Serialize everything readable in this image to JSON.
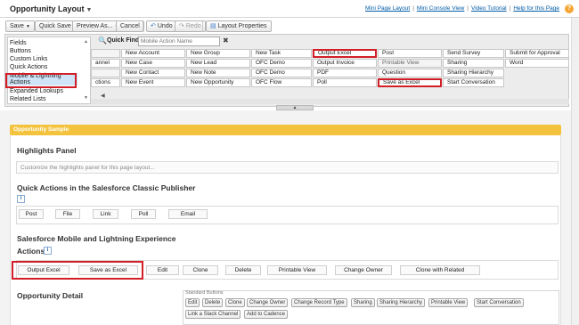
{
  "window": {
    "title": "Opportunity Layout",
    "links": [
      "Mini Page Layout",
      "Mini Console View",
      "Video Tutorial",
      "Help for this Page"
    ],
    "help_icon": "?"
  },
  "toolbar": {
    "save": "Save",
    "quick_save": "Quick Save",
    "preview_as": "Preview As...",
    "cancel": "Cancel",
    "undo": "Undo",
    "redo": "Redo",
    "layout_properties": "Layout Properties"
  },
  "palette": {
    "categories": [
      "Fields",
      "Buttons",
      "Custom Links",
      "Quick Actions",
      "Mobile & Lightning",
      "Actions",
      "Expanded Lookups",
      "Related Lists"
    ],
    "quick_find_label": "Quick Find",
    "quick_find_placeholder": "Mobile Action Name",
    "clear": "✖",
    "grid": [
      [
        "",
        "New Account",
        "New Group",
        "New Task",
        "Output Excel",
        "Post",
        "Send Survey",
        "Submit for Approval"
      ],
      [
        "annel",
        "New Case",
        "New Lead",
        "OFC Demo",
        "Output Invoice",
        "Printable View",
        "Sharing",
        "Word"
      ],
      [
        "",
        "New Contact",
        "New Note",
        "OFC Demo",
        "PDF",
        "Question",
        "Sharing Hierarchy",
        ""
      ],
      [
        "ctions",
        "New Event",
        "New Opportunity",
        "OFC Flow",
        "Poll",
        "Save as Excel",
        "Start Conversation",
        ""
      ]
    ],
    "splitter_glyph": "▲",
    "left_arrow": "◀"
  },
  "canvas": {
    "sample_title": "Opportunity Sample",
    "highlights_title": "Highlights Panel",
    "highlights_placeholder": "Customize the highlights panel for this page layout...",
    "classic_title": "Quick Actions in the Salesforce Classic Publisher",
    "info": "i",
    "classic_actions": [
      "Post",
      "File",
      "Link",
      "Poll",
      "Email"
    ],
    "mobile_title_line1": "Salesforce Mobile and Lightning Experience",
    "mobile_title_line2": "Actions",
    "mobile_actions": [
      "Output Excel",
      "Save as Excel",
      "Edit",
      "Clone",
      "Delete",
      "Printable View",
      "Change Owner",
      "Clone with Related"
    ],
    "detail_title": "Opportunity Detail",
    "standard_buttons_label": "Standard Buttons",
    "standard_buttons": [
      "Edit",
      "Delete",
      "Clone",
      "Change Owner",
      "Change Record Type",
      "Sharing",
      "Sharing Hierarchy",
      "Printable View",
      "Start Conversation",
      "Link a Slack Channel",
      "Add to Cadence"
    ]
  },
  "colors": {
    "highlight": "#d21f27",
    "sample_bar": "#f3c33e",
    "link": "#015ba7",
    "selected_category": "#cfe5f7"
  }
}
